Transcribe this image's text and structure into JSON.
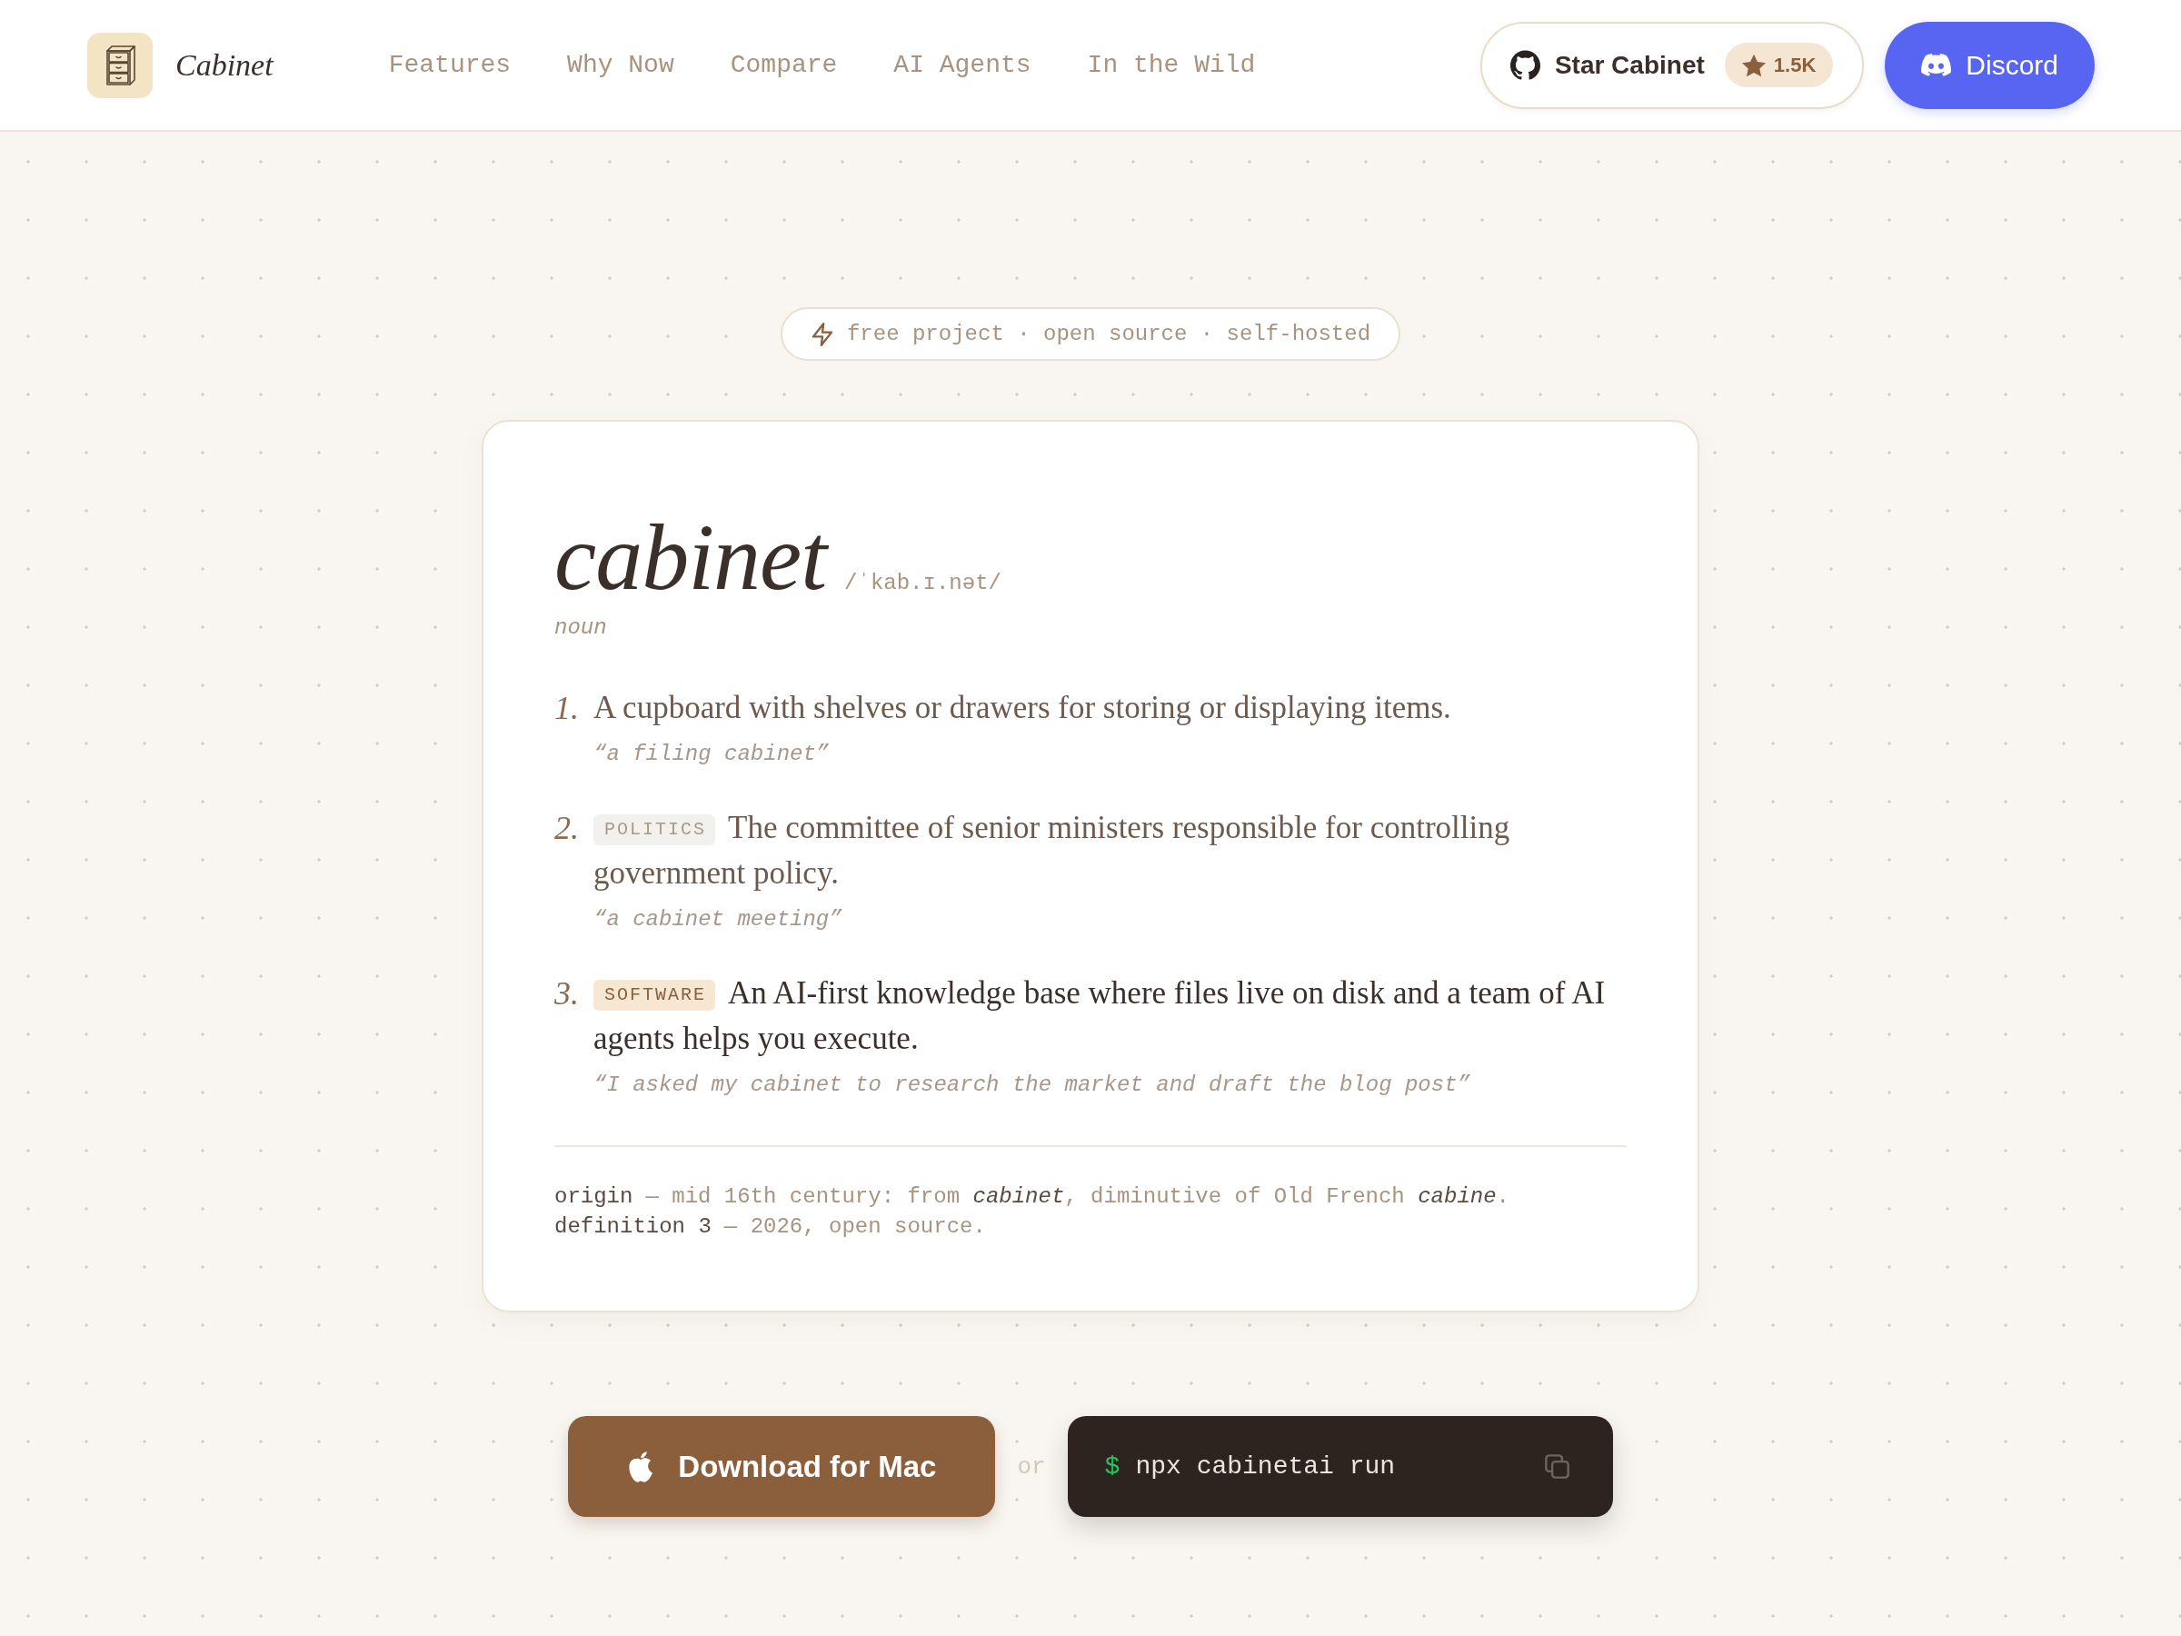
{
  "header": {
    "brand": "Cabinet",
    "nav": [
      "Features",
      "Why Now",
      "Compare",
      "AI Agents",
      "In the Wild"
    ],
    "star_button": {
      "label": "Star Cabinet",
      "count": "1.5K"
    },
    "discord_button": {
      "label": "Discord"
    }
  },
  "tagline": "free project · open source · self-hosted",
  "entry": {
    "word": "cabinet",
    "pronunciation": "/ˈkab.ɪ.nət/",
    "part_of_speech": "noun",
    "definitions": [
      {
        "number": "1.",
        "text": "A cupboard with shelves or drawers for storing or displaying items.",
        "example": "“a filing cabinet”",
        "highlighted": false
      },
      {
        "number": "2.",
        "tag": "POLITICS",
        "text": "The committee of senior ministers responsible for controlling government policy.",
        "example": "“a cabinet meeting”",
        "highlighted": false
      },
      {
        "number": "3.",
        "tag": "SOFTWARE",
        "text": "An AI-first knowledge base where files live on disk and a team of AI agents helps you execute.",
        "example": "“I asked my cabinet to research the market and draft the blog post”",
        "highlighted": true
      }
    ],
    "notes": [
      {
        "label": "origin",
        "text": "— mid 16th century: from *cabinet*, diminutive of Old French *cabine*."
      },
      {
        "label": "definition 3",
        "text": "— 2026, open source."
      }
    ]
  },
  "actions": {
    "download_button": "Download for Mac",
    "separator": "or",
    "command": {
      "prompt": "$",
      "text": "npx cabinetai run"
    }
  }
}
